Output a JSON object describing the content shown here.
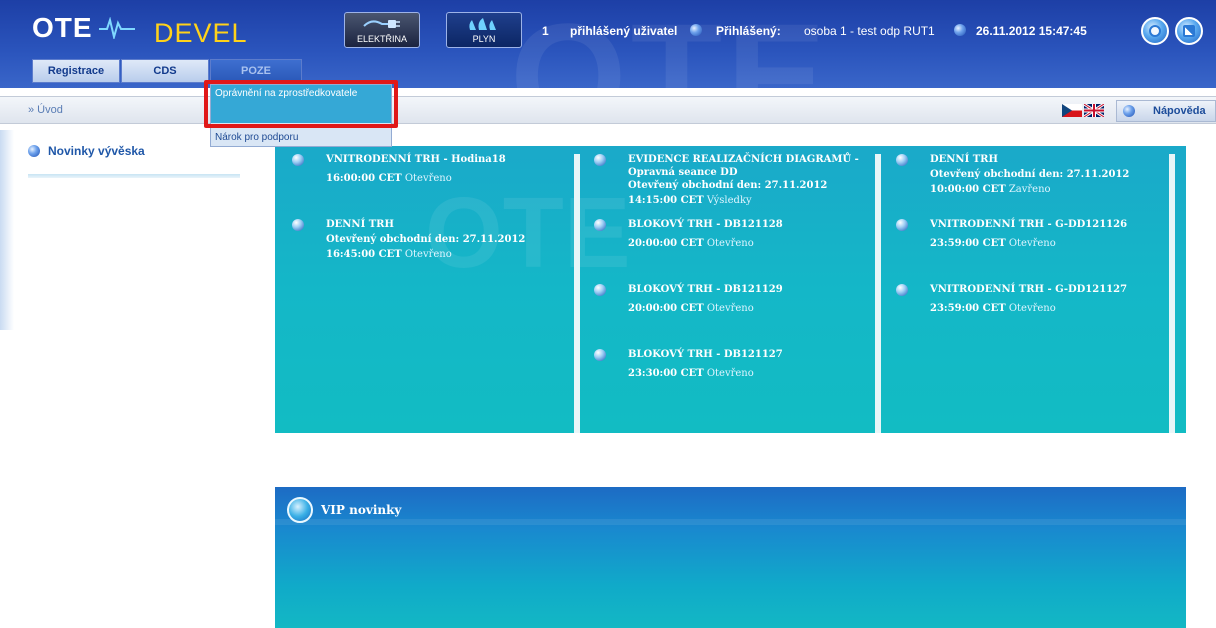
{
  "header": {
    "logo": "OTE",
    "env": "DEVEL",
    "commodities": [
      "ELEKTŘINA",
      "PLYN"
    ],
    "count": "1",
    "logged_users_label": "přihlášený uživatel",
    "logged_in_label": "Přihlášený:",
    "user": "osoba 1 - test odp RUT1",
    "datetime": "26.11.2012 15:47:45"
  },
  "tabs": [
    "Registrace",
    "CDS",
    "POZE"
  ],
  "dropdown": {
    "items": [
      "Oprávnění na zprostředkovatele",
      "Nárok pro podporu"
    ]
  },
  "breadcrumb": "» Úvod",
  "help_label": "Nápověda",
  "sidebar": {
    "title": "Novinky vývěska"
  },
  "news": {
    "col1": [
      {
        "title": "VNITRODENNÍ TRH - Hodina18",
        "line2": "",
        "time": "16:00:00 CET",
        "status": "Otevřeno"
      },
      {
        "title": "DENNÍ TRH",
        "line2": "Otevřený obchodní den: 27.11.2012",
        "time": "16:45:00 CET",
        "status": "Otevřeno"
      }
    ],
    "col2": [
      {
        "title": "EVIDENCE REALIZAČNÍCH DIAGRAMŮ -",
        "sub": "Opravná seance DD",
        "line2": "Otevřený obchodní den: 27.11.2012",
        "time": "14:15:00 CET",
        "status": "Výsledky"
      },
      {
        "title": "BLOKOVÝ TRH - DB121128",
        "line2": "",
        "time": "20:00:00 CET",
        "status": "Otevřeno"
      },
      {
        "title": "BLOKOVÝ TRH - DB121129",
        "line2": "",
        "time": "20:00:00 CET",
        "status": "Otevřeno"
      },
      {
        "title": "BLOKOVÝ TRH - DB121127",
        "line2": "",
        "time": "23:30:00 CET",
        "status": "Otevřeno"
      }
    ],
    "col3": [
      {
        "title": "DENNÍ TRH",
        "line2": "Otevřený obchodní den: 27.11.2012",
        "time": "10:00:00 CET",
        "status": "Zavřeno"
      },
      {
        "title": "VNITRODENNÍ TRH - G-DD121126",
        "line2": "",
        "time": "23:59:00 CET",
        "status": "Otevřeno"
      },
      {
        "title": "VNITRODENNÍ TRH - G-DD121127",
        "line2": "",
        "time": "23:59:00 CET",
        "status": "Otevřeno"
      }
    ]
  },
  "vip": {
    "title": "VIP novinky"
  },
  "colors": {
    "accent": "#1aa9c9",
    "header": "#2450b8",
    "env": "#ffd21a",
    "highlight": "#e01818"
  }
}
